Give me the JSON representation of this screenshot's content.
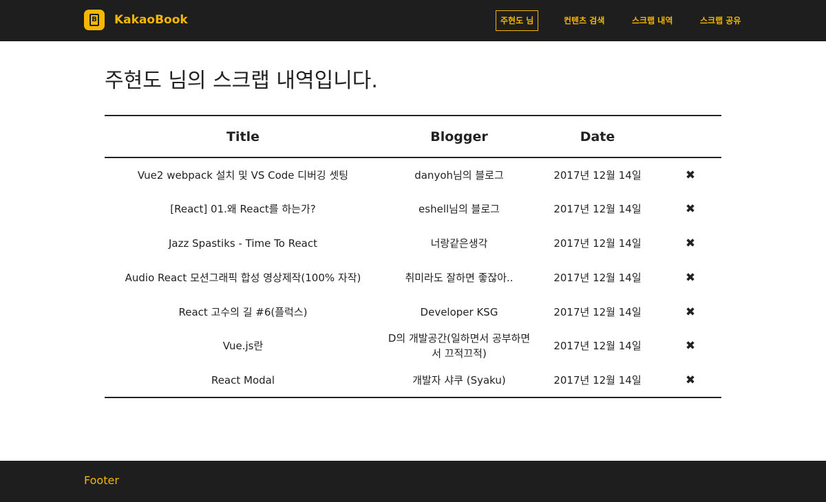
{
  "header": {
    "brand": "KakaoBook",
    "logo_letter": "B",
    "nav": [
      {
        "label": "주현도 님",
        "active": true
      },
      {
        "label": "컨텐츠 검색",
        "active": false
      },
      {
        "label": "스크랩 내역",
        "active": false
      },
      {
        "label": "스크랩 공유",
        "active": false
      }
    ]
  },
  "main": {
    "title": "주현도 님의 스크랩 내역입니다.",
    "table": {
      "columns": [
        "Title",
        "Blogger",
        "Date"
      ],
      "delete_icon": "✖",
      "rows": [
        {
          "title": "Vue2 webpack 설치 및 VS Code 디버깅 셋팅",
          "blogger": "danyoh님의 블로그",
          "date": "2017년 12월 14일"
        },
        {
          "title": "[React] 01.왜 React를 하는가?",
          "blogger": "eshell님의 블로그",
          "date": "2017년 12월 14일"
        },
        {
          "title": "Jazz Spastiks - Time To React",
          "blogger": "너랑같은생각",
          "date": "2017년 12월 14일"
        },
        {
          "title": "Audio React 모션그래픽 합성 영상제작(100% 자작)",
          "blogger": "취미라도 잘하면 좋잖아..",
          "date": "2017년 12월 14일"
        },
        {
          "title": "React 고수의 길 #6(플럭스)",
          "blogger": "Developer KSG",
          "date": "2017년 12월 14일"
        },
        {
          "title": "Vue.js란",
          "blogger": "D의 개발공간(일하면서 공부하면서 끄적끄적)",
          "date": "2017년 12월 14일"
        },
        {
          "title": "React Modal",
          "blogger": "개발자 샤쿠 (Syaku)",
          "date": "2017년 12월 14일"
        }
      ]
    }
  },
  "footer": {
    "text": "Footer"
  },
  "colors": {
    "bar": "#1e1e1e",
    "accent": "#f5b700",
    "text": "#222222"
  }
}
